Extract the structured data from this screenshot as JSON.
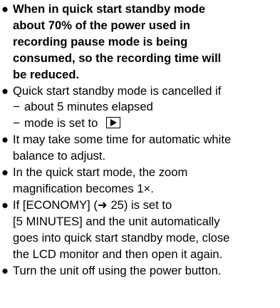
{
  "bullet_symbol": "●",
  "items": [
    {
      "bold": true,
      "lines": [
        "When in quick start standby mode",
        "about 70% of the power used in",
        "recording pause mode is being",
        "consumed, so the recording time will",
        "be reduced."
      ]
    },
    {
      "bold": false,
      "lines": [
        "Quick start standby mode is cancelled if"
      ],
      "sub_items": [
        {
          "dash": "−",
          "text": "about 5 minutes elapsed"
        },
        {
          "dash": "−",
          "text": "mode is set to",
          "icon": "play-mode-icon"
        }
      ]
    },
    {
      "bold": false,
      "lines": [
        "It may take some time for automatic white",
        "balance to adjust."
      ]
    },
    {
      "bold": false,
      "lines": [
        "In the quick start mode, the zoom",
        "magnification becomes 1×."
      ]
    },
    {
      "bold": false,
      "lines": [
        "If [ECONOMY] (➜ 25) is set to",
        "[5 MINUTES] and the unit automatically",
        "goes into quick start standby mode, close",
        "the LCD monitor and then open it again."
      ]
    },
    {
      "bold": false,
      "lines": [
        "Turn the unit off using the power button."
      ]
    }
  ]
}
